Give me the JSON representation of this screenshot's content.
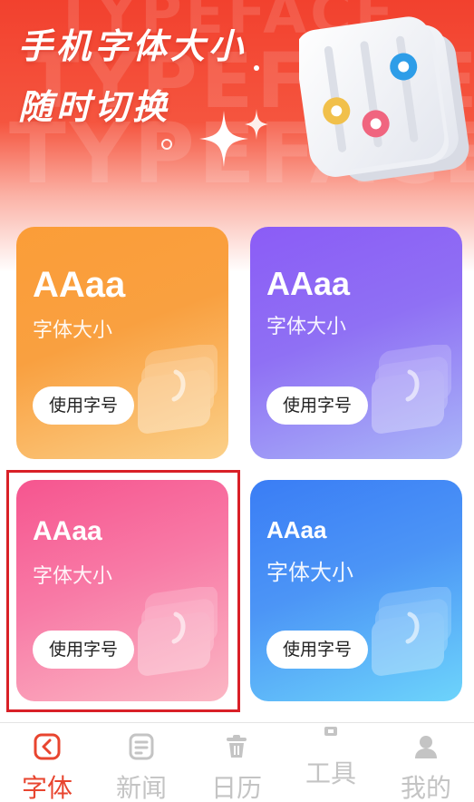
{
  "banner": {
    "title_line1": "手机字体大小",
    "title_line2": "随时切换",
    "watermark": "TYPEFACE"
  },
  "colors": {
    "accent": "#e8452f",
    "banner_red": "#f2412e",
    "tab_inactive": "#c4c4c4"
  },
  "cards": [
    {
      "sample": "AAaa",
      "label": "字体大小",
      "button": "使用字号",
      "color": "orange"
    },
    {
      "sample": "AAaa",
      "label": "字体大小",
      "button": "使用字号",
      "color": "purple"
    },
    {
      "sample": "AAaa",
      "label": "字体大小",
      "button": "使用字号",
      "color": "pink"
    },
    {
      "sample": "AAaa",
      "label": "字体大小",
      "button": "使用字号",
      "color": "blue"
    }
  ],
  "tabs": [
    {
      "label": "字体",
      "icon": "font-icon",
      "active": true
    },
    {
      "label": "新闻",
      "icon": "news-icon",
      "active": false
    },
    {
      "label": "日历",
      "icon": "trash-icon",
      "active": false
    },
    {
      "label": "工具",
      "icon": "toolbox-icon",
      "active": false
    },
    {
      "label": "我的",
      "icon": "user-icon",
      "active": false
    }
  ]
}
